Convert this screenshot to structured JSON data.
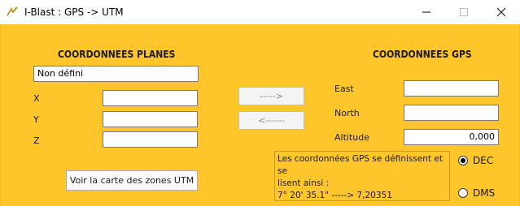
{
  "window": {
    "title": "I-Blast : GPS -> UTM",
    "icon": "iblast-app-icon"
  },
  "left_panel": {
    "heading": "COORDONNEES PLANES",
    "zone_value": "Non défini",
    "x_label": "X",
    "x_value": "",
    "y_label": "Y",
    "y_value": "",
    "z_label": "Z",
    "z_value": "",
    "map_button_label": "Voir la carte des zones UTM"
  },
  "middle": {
    "to_gps_label": "----->",
    "to_utm_label": "<------"
  },
  "right_panel": {
    "heading": "COORDONNEES GPS",
    "east_label": "East",
    "east_value": "",
    "north_label": "North",
    "north_value": "",
    "altitude_label": "Altitude",
    "altitude_value": "0,000",
    "info_line1": "Les coordonnées GPS se définissent et se",
    "info_line2": "lisent ainsi :",
    "info_line3": "7° 20' 35.1\" -----> 7,20351",
    "format_options": [
      {
        "label": "DEC",
        "selected": true
      },
      {
        "label": "DMS",
        "selected": false
      }
    ]
  },
  "colors": {
    "background": "#fec62b"
  }
}
